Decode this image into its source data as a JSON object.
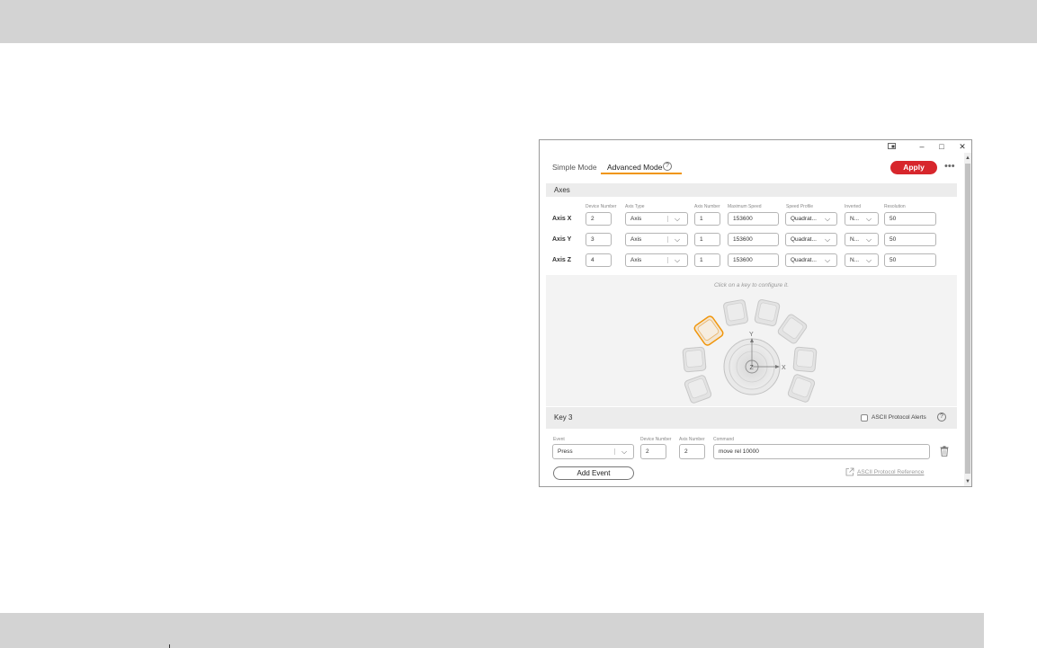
{
  "window": {
    "controls": {
      "minimize": "–",
      "maximize": "□",
      "close": "✕"
    }
  },
  "tabs": [
    {
      "label": "Simple Mode"
    },
    {
      "label": "Advanced Mode"
    }
  ],
  "help_glyph": "?",
  "apply_label": "Apply",
  "more_glyph": "•••",
  "axes": {
    "title": "Axes",
    "columns": [
      "Device Number",
      "Axis Type",
      "Axis Number",
      "Maximum Speed",
      "Speed Profile",
      "Inverted",
      "Resolution"
    ],
    "rows": [
      {
        "label": "Axis X",
        "device": "2",
        "type": "Axis",
        "axis_number": "1",
        "max_speed": "153600",
        "profile": "Quadrat...",
        "inverted": "N...",
        "resolution": "50"
      },
      {
        "label": "Axis Y",
        "device": "3",
        "type": "Axis",
        "axis_number": "1",
        "max_speed": "153600",
        "profile": "Quadrat...",
        "inverted": "N...",
        "resolution": "50"
      },
      {
        "label": "Axis Z",
        "device": "4",
        "type": "Axis",
        "axis_number": "1",
        "max_speed": "153600",
        "profile": "Quadrat...",
        "inverted": "N...",
        "resolution": "50"
      }
    ]
  },
  "keypad": {
    "hint": "Click on a key to configure it.",
    "y_label": "Y",
    "x_label": "X",
    "z_label": "Z",
    "selected_key": 3
  },
  "key_section": {
    "title": "Key 3",
    "ascii_alerts_label": "ASCII Protocol Alerts",
    "ascii_alerts_checked": false,
    "columns": {
      "event": "Event",
      "device": "Device Number",
      "axis": "Axis Number",
      "command": "Command"
    },
    "event": "Press",
    "device": "2",
    "axis": "2",
    "command": "move rel 10000",
    "add_event_label": "Add Event",
    "reference_link": "ASCII Protocol Reference"
  },
  "colors": {
    "accent": "#f0950a",
    "apply": "#d7262c",
    "band": "#d3d3d3"
  }
}
